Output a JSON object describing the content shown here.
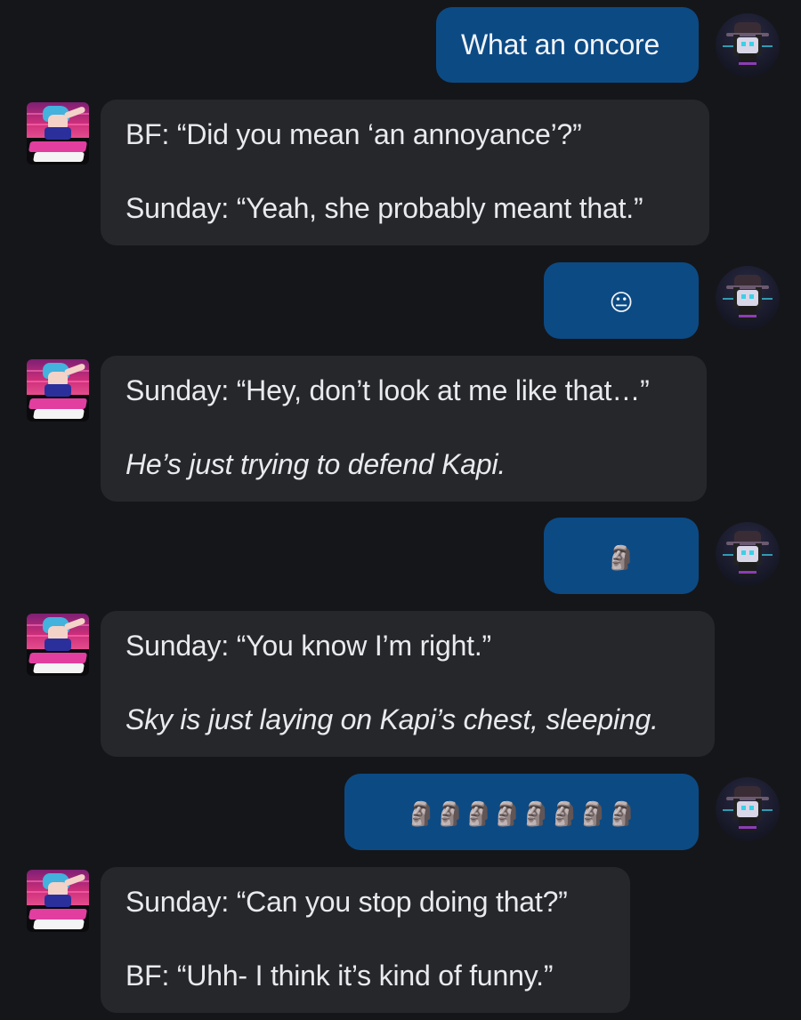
{
  "messages": [
    {
      "sender": "user",
      "text": "What an oncore"
    },
    {
      "sender": "bot",
      "lines": [
        {
          "text": "BF: “Did you mean ‘an annoyance’?”",
          "italic": false
        },
        {
          "text": "Sunday: “Yeah, she probably meant that.”",
          "italic": false
        }
      ]
    },
    {
      "sender": "user",
      "text": "😐"
    },
    {
      "sender": "bot",
      "lines": [
        {
          "text": "Sunday: “Hey, don’t look at me like that…”",
          "italic": false
        },
        {
          "text": "He’s just trying to defend Kapi.",
          "italic": true
        }
      ]
    },
    {
      "sender": "user",
      "text": "🗿"
    },
    {
      "sender": "bot",
      "lines": [
        {
          "text": "Sunday: “You know I’m right.”",
          "italic": false
        },
        {
          "text": "Sky is just laying on Kapi’s chest, sleeping.",
          "italic": true
        }
      ]
    },
    {
      "sender": "user",
      "text": "🗿🗿🗿🗿🗿🗿🗿🗿"
    },
    {
      "sender": "bot",
      "lines": [
        {
          "text": "Sunday: “Can you stop doing that?”",
          "italic": false
        },
        {
          "text": "BF: “Uhh- I think it’s kind of funny.”",
          "italic": false
        }
      ]
    }
  ],
  "icons": {
    "user_avatar": "user-avatar-icon",
    "bot_avatar": "bot-avatar-icon"
  },
  "colors": {
    "background": "#151619",
    "user_bubble": "#0c4a84",
    "bot_bubble": "#26272b"
  }
}
